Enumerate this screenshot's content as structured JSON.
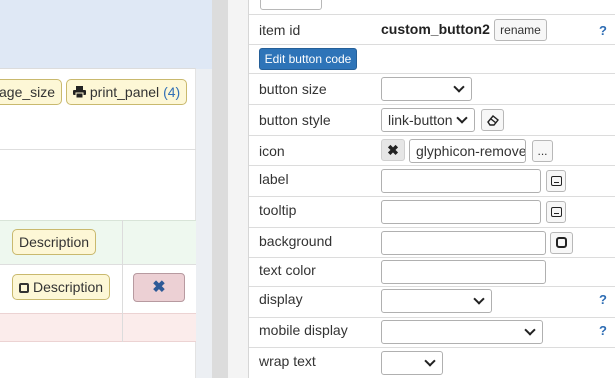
{
  "preview": {
    "chips_row": [
      {
        "label": "age_size"
      },
      {
        "icon": "printer-icon",
        "label": "print_panel",
        "count": "(4)"
      }
    ],
    "row_green_label": "Description",
    "row_plain_label": "Description",
    "delete_icon": "close-icon"
  },
  "panel": {
    "item_id_label": "item id",
    "item_id_value": "custom_button2",
    "rename_label": "rename",
    "edit_button_label": "Edit button code",
    "rows": {
      "button_size": "button size",
      "button_style": "button style",
      "button_style_value": "link-button",
      "icon": "icon",
      "icon_value": "glyphicon-remove",
      "icon_more": "...",
      "label": "label",
      "tooltip": "tooltip",
      "background": "background",
      "text_color": "text color",
      "display": "display",
      "mobile_display": "mobile display",
      "wrap_text": "wrap text"
    },
    "help_mark": "?"
  },
  "colors": {
    "accent": "#2e74b8",
    "chip_bg": "#fdf7d6",
    "danger_bg": "#ecd0d4",
    "row_success": "#eef8ef",
    "row_danger": "#fbeceb"
  }
}
